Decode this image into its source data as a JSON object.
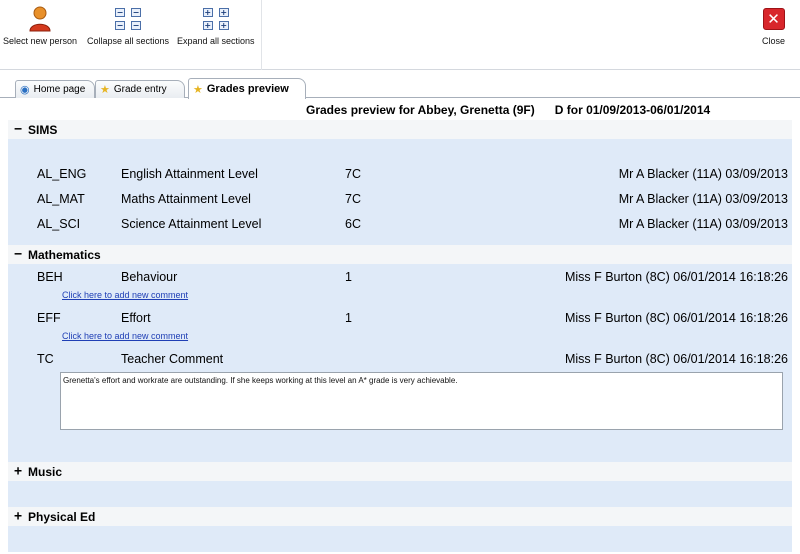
{
  "toolbar": {
    "select_label": "Select new person",
    "collapse_label": "Collapse all sections",
    "expand_label": "Expand all sections",
    "close_label": "Close"
  },
  "tabs": [
    {
      "label": "Home page",
      "icon": "globe-icon"
    },
    {
      "label": "Grade entry",
      "icon": "star-icon"
    },
    {
      "label": "Grades preview",
      "icon": "star-icon",
      "active": true
    }
  ],
  "preview": {
    "title": "Grades preview for Abbey, Grenetta (9F)",
    "period": "D for 01/09/2013-06/01/2014"
  },
  "sections": {
    "sims": {
      "title": "SIMS",
      "rows": [
        {
          "code": "AL_ENG",
          "name": "English Attainment Level",
          "grade": "7C",
          "by": "Mr A Blacker (11A) 03/09/2013"
        },
        {
          "code": "AL_MAT",
          "name": "Maths Attainment Level",
          "grade": "7C",
          "by": "Mr A Blacker (11A) 03/09/2013"
        },
        {
          "code": "AL_SCI",
          "name": "Science Attainment Level",
          "grade": "6C",
          "by": "Mr A Blacker (11A) 03/09/2013"
        }
      ]
    },
    "maths": {
      "title": "Mathematics",
      "add_comment_link": "Click here to add new comment",
      "rows": [
        {
          "code": "BEH",
          "name": "Behaviour",
          "grade": "1",
          "by": "Miss F Burton (8C) 06/01/2014 16:18:26"
        },
        {
          "code": "EFF",
          "name": "Effort",
          "grade": "1",
          "by": "Miss F Burton (8C) 06/01/2014 16:18:26"
        },
        {
          "code": "TC",
          "name": "Teacher Comment",
          "grade": "",
          "by": "Miss F Burton (8C) 06/01/2014 16:18:26"
        }
      ],
      "comment": "Grenetta's effort and workrate are outstanding. If she keeps working at this level an A* grade is very achievable."
    },
    "music": {
      "title": "Music"
    },
    "pe": {
      "title": "Physical Ed"
    }
  },
  "symbols": {
    "collapse": "−",
    "expand": "+",
    "plus": "+",
    "minus": "−",
    "close": "✕"
  },
  "colors": {
    "section_body": "#dfeaf8",
    "section_head": "#f4f6f8",
    "link": "#1f3fb5",
    "close": "#d8262b"
  }
}
